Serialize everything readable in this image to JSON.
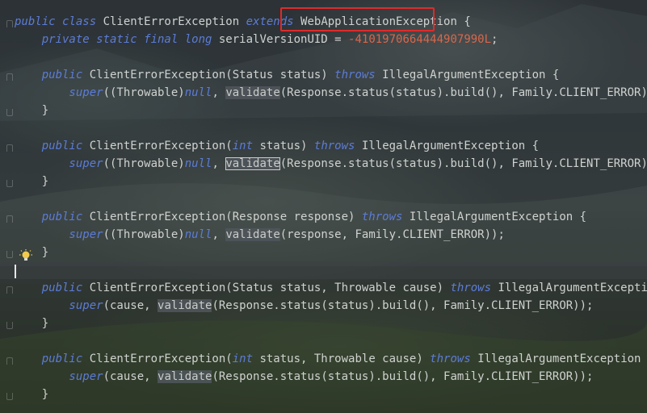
{
  "editor": {
    "lines": [
      {
        "id": "class-decl",
        "tokens": [
          {
            "t": "public class ",
            "c": "kw"
          },
          {
            "t": "ClientErrorException ",
            "c": "plain"
          },
          {
            "t": "extends ",
            "c": "kw"
          },
          {
            "t": "WebApplicationException",
            "c": "plain"
          },
          {
            "t": " {",
            "c": "plain"
          }
        ]
      },
      {
        "id": "serial-field",
        "tokens": [
          {
            "t": "    private static final long ",
            "c": "kw"
          },
          {
            "t": "serialVersionUID = ",
            "c": "plain"
          },
          {
            "t": "-4101970664444907990L",
            "c": "num"
          },
          {
            "t": ";",
            "c": "plain"
          }
        ]
      },
      {
        "id": "blank-1",
        "tokens": []
      },
      {
        "id": "ctor1-sig",
        "tokens": [
          {
            "t": "    public ",
            "c": "kw"
          },
          {
            "t": "ClientErrorException(Status status) ",
            "c": "plain"
          },
          {
            "t": "throws ",
            "c": "kw"
          },
          {
            "t": "IllegalArgumentException {",
            "c": "plain"
          }
        ]
      },
      {
        "id": "ctor1-body",
        "tokens": [
          {
            "t": "        super",
            "c": "kw"
          },
          {
            "t": "((Throwable)",
            "c": "plain"
          },
          {
            "t": "null",
            "c": "kw"
          },
          {
            "t": ", ",
            "c": "plain"
          },
          {
            "t": "validate",
            "c": "hl"
          },
          {
            "t": "(Response.status(status).build(), Family.CLIENT_ERROR));",
            "c": "plain"
          }
        ]
      },
      {
        "id": "ctor1-end",
        "tokens": [
          {
            "t": "    }",
            "c": "plain"
          }
        ]
      },
      {
        "id": "blank-2",
        "tokens": []
      },
      {
        "id": "ctor2-sig",
        "tokens": [
          {
            "t": "    public ",
            "c": "kw"
          },
          {
            "t": "ClientErrorException(",
            "c": "plain"
          },
          {
            "t": "int ",
            "c": "kw"
          },
          {
            "t": "status) ",
            "c": "plain"
          },
          {
            "t": "throws ",
            "c": "kw"
          },
          {
            "t": "IllegalArgumentException {",
            "c": "plain"
          }
        ]
      },
      {
        "id": "ctor2-body",
        "tokens": [
          {
            "t": "        super",
            "c": "kw"
          },
          {
            "t": "((Throwable)",
            "c": "plain"
          },
          {
            "t": "null",
            "c": "kw"
          },
          {
            "t": ", ",
            "c": "plain"
          },
          {
            "t": "validate",
            "c": "boxed"
          },
          {
            "t": "(Response.status(status).build(), Family.CLIENT_ERROR));",
            "c": "plain"
          }
        ]
      },
      {
        "id": "ctor2-end",
        "tokens": [
          {
            "t": "    }",
            "c": "plain"
          }
        ]
      },
      {
        "id": "blank-3",
        "tokens": []
      },
      {
        "id": "ctor3-sig",
        "tokens": [
          {
            "t": "    public ",
            "c": "kw"
          },
          {
            "t": "ClientErrorException(Response response) ",
            "c": "plain"
          },
          {
            "t": "throws ",
            "c": "kw"
          },
          {
            "t": "IllegalArgumentException {",
            "c": "plain"
          }
        ]
      },
      {
        "id": "ctor3-body",
        "tokens": [
          {
            "t": "        super",
            "c": "kw"
          },
          {
            "t": "((Throwable)",
            "c": "plain"
          },
          {
            "t": "null",
            "c": "kw"
          },
          {
            "t": ", ",
            "c": "plain"
          },
          {
            "t": "validate",
            "c": "hl"
          },
          {
            "t": "(response, Family.CLIENT_ERROR));",
            "c": "plain"
          }
        ]
      },
      {
        "id": "ctor3-end",
        "tokens": [
          {
            "t": "    }",
            "c": "plain"
          }
        ]
      },
      {
        "id": "caret-line",
        "tokens": [],
        "current": true
      },
      {
        "id": "ctor4-sig",
        "tokens": [
          {
            "t": "    public ",
            "c": "kw"
          },
          {
            "t": "ClientErrorException(Status status, Throwable cause) ",
            "c": "plain"
          },
          {
            "t": "throws ",
            "c": "kw"
          },
          {
            "t": "IllegalArgumentException {",
            "c": "plain"
          }
        ]
      },
      {
        "id": "ctor4-body",
        "tokens": [
          {
            "t": "        super",
            "c": "kw"
          },
          {
            "t": "(cause, ",
            "c": "plain"
          },
          {
            "t": "validate",
            "c": "hl"
          },
          {
            "t": "(Response.status(status).build(), Family.CLIENT_ERROR));",
            "c": "plain"
          }
        ]
      },
      {
        "id": "ctor4-end",
        "tokens": [
          {
            "t": "    }",
            "c": "plain"
          }
        ]
      },
      {
        "id": "blank-4",
        "tokens": []
      },
      {
        "id": "ctor5-sig",
        "tokens": [
          {
            "t": "    public ",
            "c": "kw"
          },
          {
            "t": "ClientErrorException(",
            "c": "plain"
          },
          {
            "t": "int ",
            "c": "kw"
          },
          {
            "t": "status, Throwable cause) ",
            "c": "plain"
          },
          {
            "t": "throws ",
            "c": "kw"
          },
          {
            "t": "IllegalArgumentException {",
            "c": "plain"
          }
        ]
      },
      {
        "id": "ctor5-body",
        "tokens": [
          {
            "t": "        super",
            "c": "kw"
          },
          {
            "t": "(cause, ",
            "c": "plain"
          },
          {
            "t": "validate",
            "c": "hl"
          },
          {
            "t": "(Response.status(status).build(), Family.CLIENT_ERROR));",
            "c": "plain"
          }
        ]
      },
      {
        "id": "ctor5-end",
        "tokens": [
          {
            "t": "    }",
            "c": "plain"
          }
        ]
      }
    ]
  },
  "annotation": {
    "highlight_color": "#e02a2a"
  },
  "colors": {
    "keyword": "#5c7cd6",
    "number": "#d8674b",
    "text": "#cfd2cf"
  },
  "icons": {
    "intention": "lightbulb-icon"
  }
}
